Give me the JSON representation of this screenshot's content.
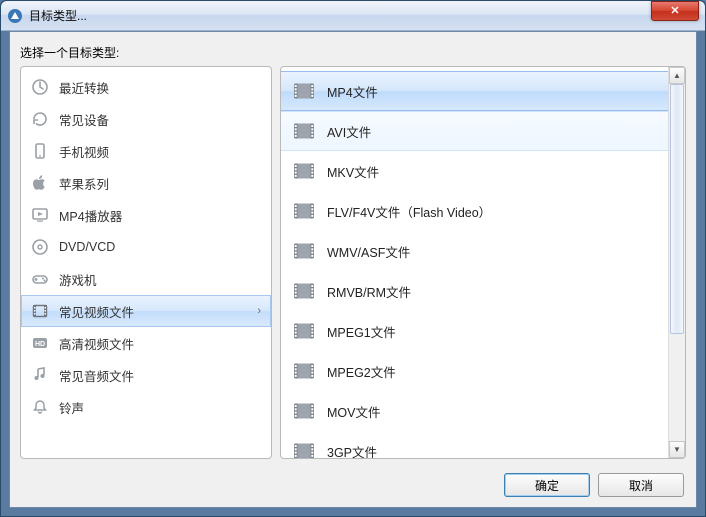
{
  "window": {
    "title": "目标类型...",
    "close_glyph": "✕"
  },
  "prompt": "选择一个目标类型:",
  "categories": [
    {
      "label": "最近转换",
      "icon": "clock-icon",
      "selected": false
    },
    {
      "label": "常见设备",
      "icon": "refresh-icon",
      "selected": false
    },
    {
      "label": "手机视频",
      "icon": "phone-icon",
      "selected": false
    },
    {
      "label": "苹果系列",
      "icon": "apple-icon",
      "selected": false
    },
    {
      "label": "MP4播放器",
      "icon": "player-icon",
      "selected": false
    },
    {
      "label": "DVD/VCD",
      "icon": "disc-icon",
      "selected": false
    },
    {
      "label": "游戏机",
      "icon": "gamepad-icon",
      "selected": false
    },
    {
      "label": "常见视频文件",
      "icon": "film-icon",
      "selected": true
    },
    {
      "label": "高清视频文件",
      "icon": "hd-icon",
      "selected": false
    },
    {
      "label": "常见音频文件",
      "icon": "music-icon",
      "selected": false
    },
    {
      "label": "铃声",
      "icon": "bell-icon",
      "selected": false
    }
  ],
  "files": [
    {
      "label": "MP4文件",
      "state": "selected"
    },
    {
      "label": "AVI文件",
      "state": "hover"
    },
    {
      "label": "MKV文件",
      "state": ""
    },
    {
      "label": "FLV/F4V文件（Flash Video）",
      "state": ""
    },
    {
      "label": "WMV/ASF文件",
      "state": ""
    },
    {
      "label": "RMVB/RM文件",
      "state": ""
    },
    {
      "label": "MPEG1文件",
      "state": ""
    },
    {
      "label": "MPEG2文件",
      "state": ""
    },
    {
      "label": "MOV文件",
      "state": ""
    },
    {
      "label": "3GP文件",
      "state": ""
    }
  ],
  "buttons": {
    "ok": "确定",
    "cancel": "取消"
  },
  "chevron": "›",
  "scroll": {
    "up": "▲",
    "down": "▼"
  }
}
